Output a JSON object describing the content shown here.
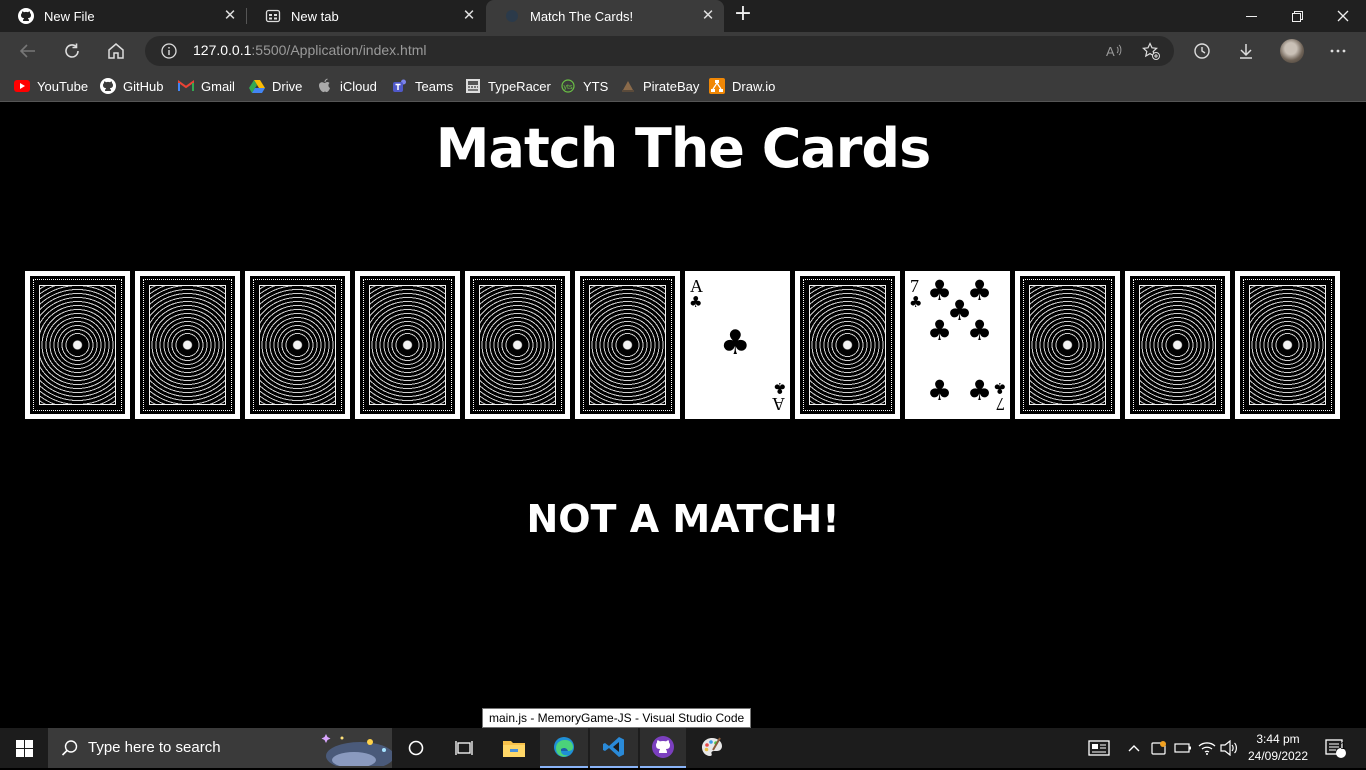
{
  "browser": {
    "tabs": [
      {
        "title": "New File",
        "icon": "github-icon",
        "active": false
      },
      {
        "title": "New tab",
        "icon": "newtab-icon",
        "active": false
      },
      {
        "title": "Match The Cards!",
        "icon": "page-icon",
        "active": true
      }
    ],
    "url_host": "127.0.0.1",
    "url_rest": ":5500/Application/index.html",
    "bookmarks": [
      {
        "label": "YouTube",
        "icon": "youtube-icon",
        "color": "#ff0000"
      },
      {
        "label": "GitHub",
        "icon": "github-icon",
        "color": "#ffffff"
      },
      {
        "label": "Gmail",
        "icon": "gmail-icon",
        "color": "#ea4335"
      },
      {
        "label": "Drive",
        "icon": "drive-icon",
        "color": "#34a853"
      },
      {
        "label": "iCloud",
        "icon": "apple-icon",
        "color": "#aaaaaa"
      },
      {
        "label": "Teams",
        "icon": "teams-icon",
        "color": "#5059c9"
      },
      {
        "label": "TypeRacer",
        "icon": "typeracer-icon",
        "color": "#dddddd"
      },
      {
        "label": "YTS",
        "icon": "yts-icon",
        "color": "#6ac045"
      },
      {
        "label": "PirateBay",
        "icon": "piratebay-icon",
        "color": "#8a6a4a"
      },
      {
        "label": "Draw.io",
        "icon": "drawio-icon",
        "color": "#f08705"
      }
    ]
  },
  "page": {
    "title": "Match The Cards",
    "status": "NOT A MATCH!",
    "cards": [
      {
        "state": "back"
      },
      {
        "state": "back"
      },
      {
        "state": "back"
      },
      {
        "state": "back"
      },
      {
        "state": "back"
      },
      {
        "state": "back"
      },
      {
        "state": "face",
        "rank": "A",
        "suit": "♣"
      },
      {
        "state": "back"
      },
      {
        "state": "face",
        "rank": "7",
        "suit": "♣"
      },
      {
        "state": "back"
      },
      {
        "state": "back"
      },
      {
        "state": "back"
      }
    ]
  },
  "tooltip": "main.js - MemoryGame-JS - Visual Studio Code",
  "taskbar": {
    "search_placeholder": "Type here to search",
    "time": "3:44 pm",
    "date": "24/09/2022",
    "notification_count": "1"
  }
}
